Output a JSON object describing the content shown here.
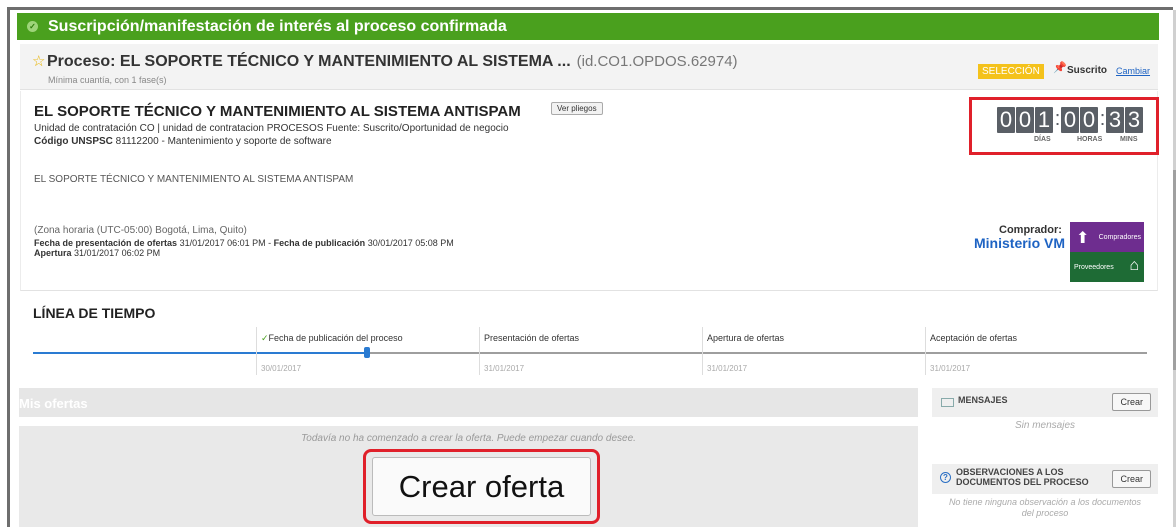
{
  "banner": {
    "title": "Suscripción/manifestación de interés al proceso confirmada"
  },
  "process": {
    "title": "Proceso: EL SOPORTE TÉCNICO Y MANTENIMIENTO AL SISTEMA ...",
    "id": "(id.CO1.OPDOS.62974)",
    "subtitle": "Mínima cuantía, con 1 fase(s)",
    "badge": "SELECCIÓN",
    "subscribed_label": "Suscrito",
    "change_link": "Cambiar"
  },
  "detail": {
    "title": "EL SOPORTE TÉCNICO Y MANTENIMIENTO AL SISTEMA ANTISPAM",
    "ver_pliegos": "Ver pliegos",
    "line1": "Unidad de contratación CO | unidad de contratacion PROCESOS Fuente: Suscrito/Oportunidad de negocio",
    "code_label": "Código UNSPSC",
    "code_value": "81112200 - Mantenimiento y soporte de software",
    "description": "EL SOPORTE TÉCNICO Y MANTENIMIENTO AL SISTEMA ANTISPAM",
    "timezone": "(Zona horaria (UTC-05:00) Bogotá, Lima, Quito)",
    "presentation_label": "Fecha de presentación de ofertas",
    "presentation_value": "31/01/2017 06:01 PM",
    "separator": " - ",
    "publication_label": "Fecha de publicación",
    "publication_value": "30/01/2017 05:08 PM",
    "opening_label": "Apertura",
    "opening_value": "31/01/2017 06:02 PM"
  },
  "countdown": {
    "days": [
      "0",
      "0",
      "1"
    ],
    "hours": [
      "0",
      "0"
    ],
    "mins": [
      "3",
      "3"
    ],
    "days_label": "DÍAS",
    "hours_label": "HORAS",
    "mins_label": "MINS"
  },
  "buyer": {
    "label": "Comprador:",
    "name": "Ministerio VM",
    "logo_top": "Compradores",
    "logo_bottom": "Proveedores"
  },
  "timeline": {
    "title": "LÍNEA DE TIEMPO",
    "progress_check": "✓",
    "stages": [
      {
        "label": "Fecha de publicación del proceso",
        "date": "30/01/2017"
      },
      {
        "label": "Presentación de ofertas",
        "date": "31/01/2017"
      },
      {
        "label": "Apertura de ofertas",
        "date": "31/01/2017"
      },
      {
        "label": "Aceptación de ofertas",
        "date": "31/01/2017"
      }
    ]
  },
  "offers": {
    "title": "Mis ofertas",
    "empty_message": "Todavía no ha comenzado a crear la oferta. Puede empezar cuando desee.",
    "create_button": "Crear oferta"
  },
  "messages": {
    "title": "MENSAJES",
    "create_button": "Crear",
    "empty": "Sin mensajes"
  },
  "observations": {
    "title": "OBSERVACIONES A LOS DOCUMENTOS DEL PROCESO",
    "create_button": "Crear",
    "empty": "No tiene ninguna observación a los documentos del proceso"
  },
  "colors": {
    "banner_green": "#4aa01e",
    "highlight_red": "#e0202a",
    "link_blue": "#1e63c3",
    "badge_yellow": "#f4c21b"
  }
}
